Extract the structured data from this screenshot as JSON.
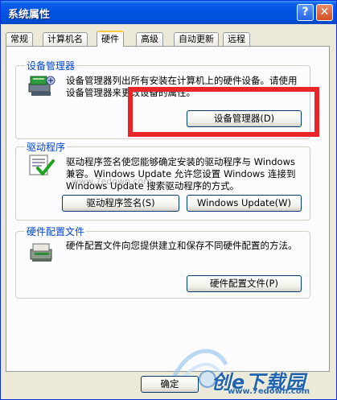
{
  "window": {
    "title": "系统属性",
    "help_glyph": "?",
    "close_glyph": "✕"
  },
  "tabs": [
    {
      "label": "常规"
    },
    {
      "label": "计算机名"
    },
    {
      "label": "硬件",
      "active": true
    },
    {
      "label": "高级"
    },
    {
      "label": "自动更新"
    },
    {
      "label": "远程"
    }
  ],
  "device_manager": {
    "title": "设备管理器",
    "description": "设备管理器列出所有安装在计算机上的硬件设备。请使用设备管理器来更改设备的属性。",
    "button": "设备管理器(D)"
  },
  "drivers": {
    "title": "驱动程序",
    "description": "驱动程序签名使您能够确定安装的驱动程序与 Windows 兼容。Windows Update 允许您设置 Windows 连接到 Windows Update 搜索驱动程序的方式。",
    "button_signing": "驱动程序签名(S)",
    "button_update": "Windows Update(W)"
  },
  "hardware_profiles": {
    "title": "硬件配置文件",
    "description": "硬件配置文件向您提供建立和保存不同硬件配置的方法。",
    "button": "硬件配置文件(P)"
  },
  "footer": {
    "ok": "确定"
  },
  "watermarks": {
    "site_small": "www.7edown.com",
    "logo_text": "创e下载园",
    "site_bottom": "www.7edown.com"
  },
  "colors": {
    "title_bar": "#0054e3",
    "highlight": "#e8262a",
    "group_title": "#0046d5"
  }
}
